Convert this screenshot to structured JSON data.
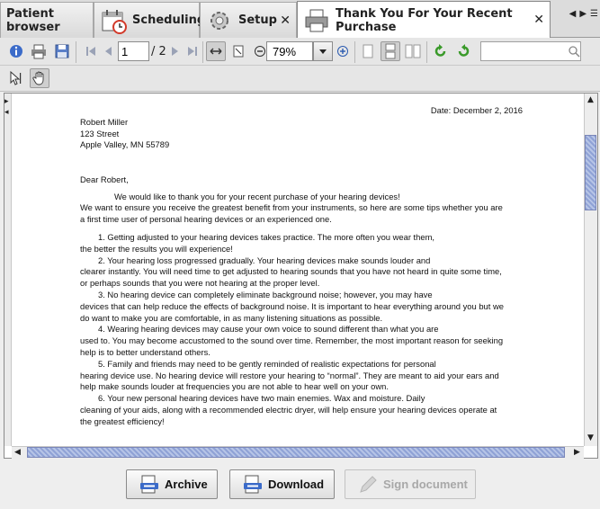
{
  "tabs": [
    {
      "label": "Patient browser"
    },
    {
      "label": "Scheduling"
    },
    {
      "label": "Setup",
      "close": "✕"
    },
    {
      "label": "Thank You For Your Recent Purchase",
      "close": "✕"
    }
  ],
  "toolbar": {
    "page_current": "1",
    "page_total": "/ 2",
    "zoom": "79%",
    "search_placeholder": ""
  },
  "document": {
    "date": "Date: December 2, 2016",
    "address": [
      "Robert Miller",
      "123 Street",
      "Apple Valley, MN 55789"
    ],
    "greeting": "Dear Robert,",
    "intro_1": "We would like to thank you for your recent purchase of your hearing devices!",
    "intro_2": "We want to ensure you receive the greatest benefit from your instruments, so here are some tips whether you are",
    "intro_3": "a first time user of personal hearing devices or an experienced one.",
    "item1_a": "1.     Getting adjusted to your hearing devices takes practice. The more often you wear them,",
    "item1_b": "the better the results you will experience!",
    "item2_a": "2.     Your hearing loss progressed gradually. Your hearing devices make sounds louder and",
    "item2_b": "clearer instantly.  You will need time to get adjusted to hearing sounds that you have not heard in quite some time,",
    "item2_c": "or perhaps sounds that you were not hearing at the proper level.",
    "item3_a": "3.     No hearing device can completely eliminate background noise; however, you may have",
    "item3_b": "devices that can help reduce the effects of background noise. It is important to hear everything around you but we",
    "item3_c": "do want to make you are comfortable, in as many listening situations as possible.",
    "item4_a": "4.     Wearing hearing devices may cause your own voice to sound different than what you are",
    "item4_b": "used to. You may become accustomed to the sound over time. Remember, the most important reason for seeking",
    "item4_c": "help is to better understand others.",
    "item5_a": "5.     Family and friends may need to be gently reminded of realistic expectations for personal",
    "item5_b": "hearing device use. No hearing device will restore your hearing to “normal”. They are meant to aid your ears and",
    "item5_c": "help make sounds louder at frequencies you are not able to hear well on your own.",
    "item6_a": "6.     Your new personal hearing devices have two main enemies. Wax and moisture. Daily",
    "item6_b": "cleaning of your aids, along with a recommended electric dryer, will help ensure your hearing devices operate at",
    "item6_c": "the greatest efficiency!"
  },
  "buttons": {
    "archive": "Archive",
    "download": "Download",
    "sign": "Sign document"
  },
  "colors": {
    "accent_blue": "#3b6bc9",
    "scroll_thumb": "#8fa2d6",
    "green_icon": "#3a9a2a",
    "clock_red": "#d23a2a"
  }
}
